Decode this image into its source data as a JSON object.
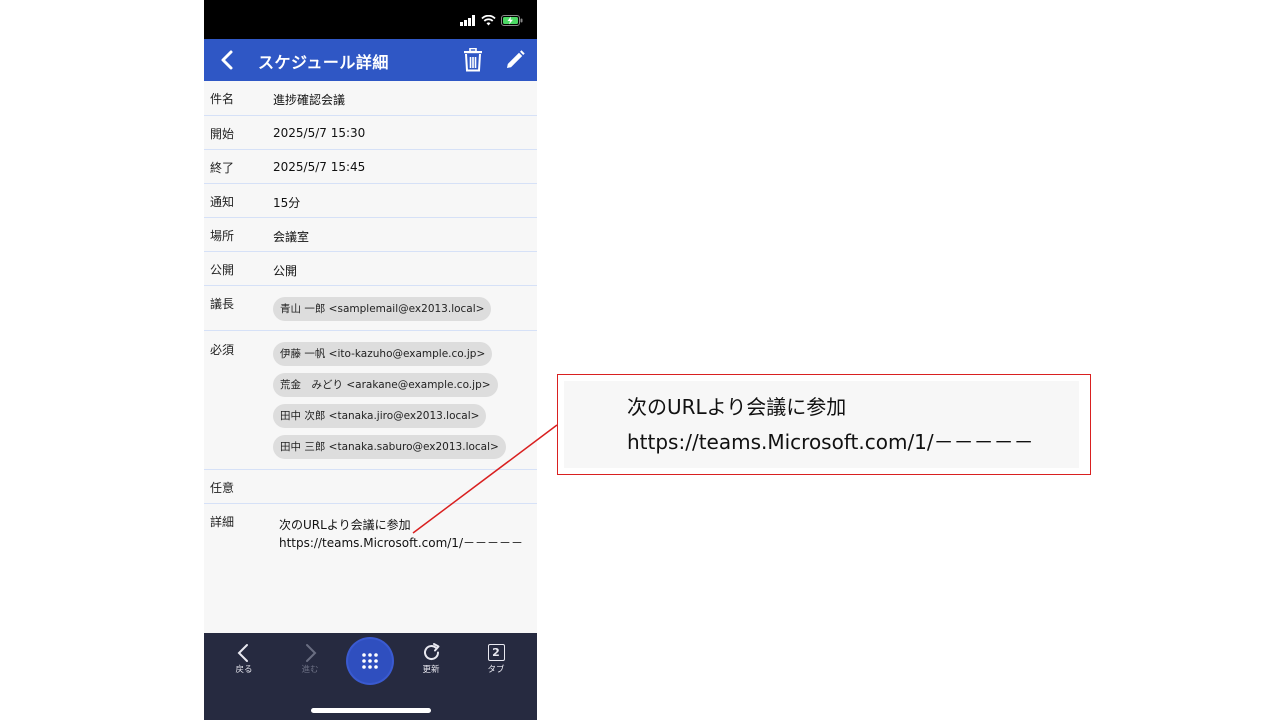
{
  "header": {
    "title": "スケジュール詳細"
  },
  "fields": [
    {
      "label": "件名",
      "value": "進捗確認会議"
    },
    {
      "label": "開始",
      "value": "2025/5/7 15:30"
    },
    {
      "label": "終了",
      "value": "2025/5/7 15:45"
    },
    {
      "label": "通知",
      "value": "15分"
    },
    {
      "label": "場所",
      "value": "会議室"
    },
    {
      "label": "公開",
      "value": "公開"
    }
  ],
  "chair": {
    "label": "議長",
    "attendees": [
      "青山 一郎 <samplemail@ex2013.local>"
    ]
  },
  "required": {
    "label": "必須",
    "attendees": [
      "伊藤 一帆 <ito-kazuho@example.co.jp>",
      "荒金　みどり <arakane@example.co.jp>",
      "田中 次郎 <tanaka.jiro@ex2013.local>",
      "田中 三郎 <tanaka.saburo@ex2013.local>"
    ]
  },
  "optional": {
    "label": "任意"
  },
  "detail": {
    "label": "詳細",
    "line1": "次のURLより会議に参加",
    "line2": "https://teams.Microsoft.com/1/－－－－－"
  },
  "bottom_nav": {
    "back": "戻る",
    "forward": "進む",
    "refresh": "更新",
    "tabs": "タブ",
    "tab_count": "2"
  },
  "callout": {
    "line1": "次のURLより会議に参加",
    "line2": "https://teams.Microsoft.com/1/－－－－－"
  },
  "colors": {
    "header_bg": "#2f57c5",
    "bottom_bar_bg": "#262a40",
    "callout_border": "#d92020"
  }
}
